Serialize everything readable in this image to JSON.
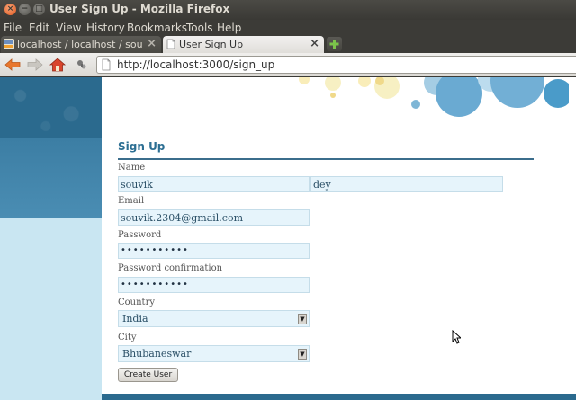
{
  "window": {
    "title": "User Sign Up - Mozilla Firefox",
    "buttons": {
      "close": "×",
      "minimize": "−",
      "maximize": "□"
    }
  },
  "menubar": {
    "items": [
      "File",
      "Edit",
      "View",
      "History",
      "Bookmarks",
      "Tools",
      "Help"
    ]
  },
  "tabs": [
    {
      "label": "localhost / localhost / souvi...",
      "active": false,
      "close": "×"
    },
    {
      "label": "User Sign Up",
      "active": true,
      "close": "×"
    }
  ],
  "navbar": {
    "url": "http://localhost:3000/sign_up"
  },
  "form": {
    "title": "Sign Up",
    "name_label": "Name",
    "first_name": "souvik",
    "last_name": "dey",
    "email_label": "Email",
    "email": "souvik.2304@gmail.com",
    "password_label": "Password",
    "password_mask": "•••••••••••",
    "password_confirmation_label": "Password confirmation",
    "password_confirmation_mask": "•••••••••••",
    "country_label": "Country",
    "country": "India",
    "city_label": "City",
    "city": "Bhubaneswar",
    "submit_label": "Create User"
  },
  "colors": {
    "accent": "#2d6f93",
    "header_dark": "#2b6a8e",
    "sidebar_light": "#c9e6f2",
    "input_bg": "#e6f4fb",
    "bubble_blue": "#4a9bc9",
    "bubble_yellow": "#f7e9a8"
  }
}
